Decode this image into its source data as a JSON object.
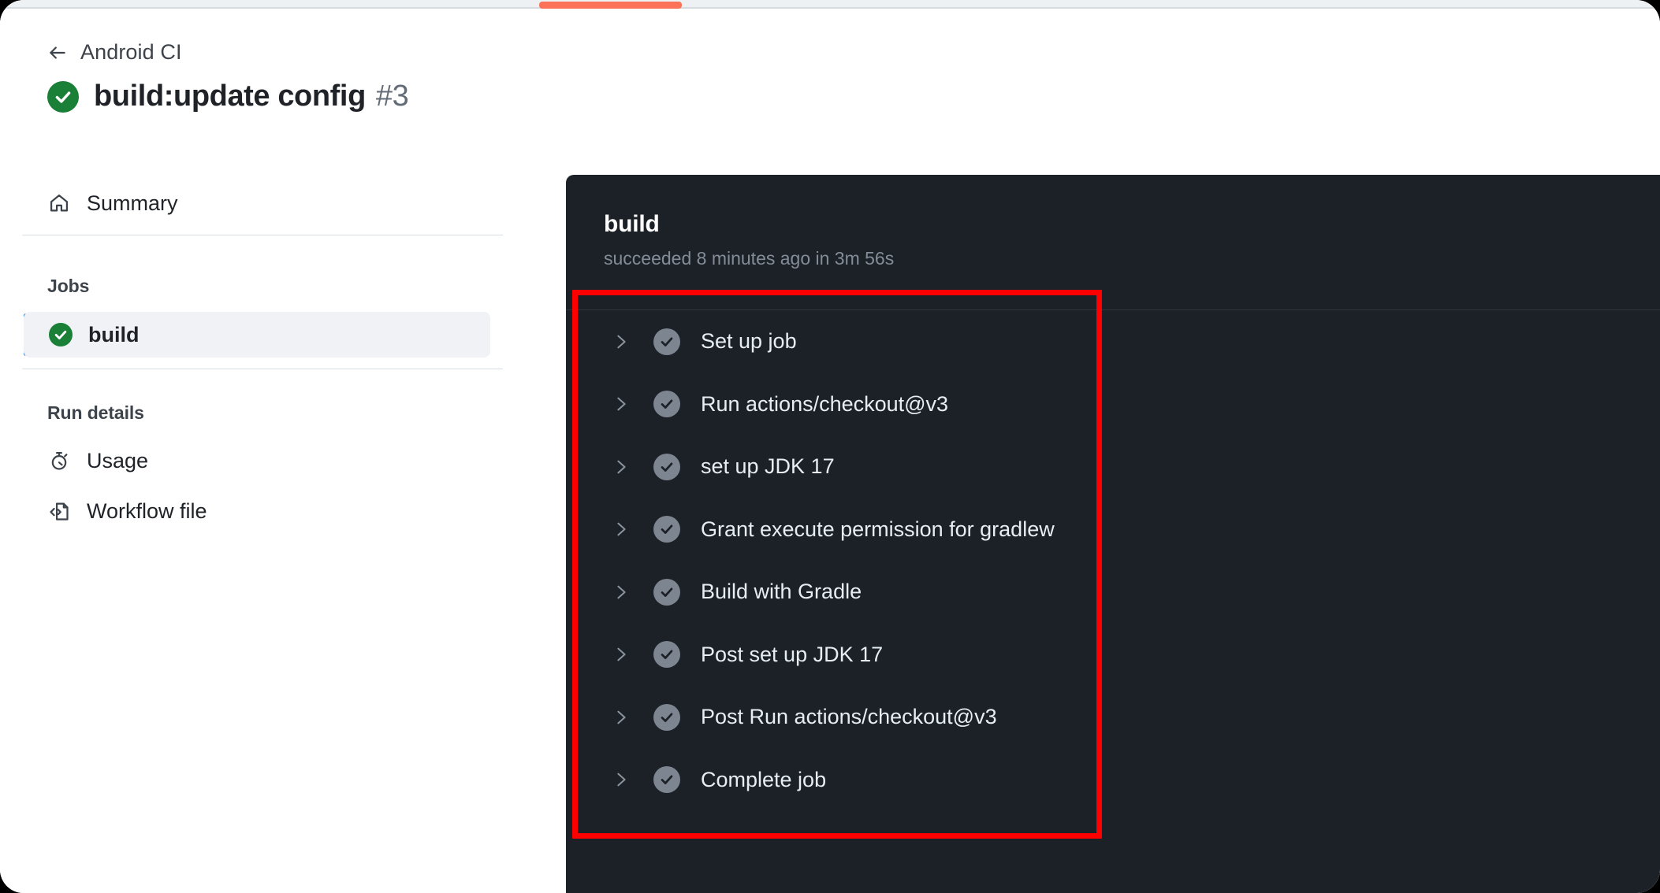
{
  "window": {
    "tab_indicator_color": "#fb7259"
  },
  "sidebar": {
    "breadcrumb": {
      "icon": "arrow-left-icon",
      "label": "Android CI"
    },
    "run_title": {
      "status_icon": "check-circle-icon",
      "status_color": "#1a7f37",
      "text": "build:update config",
      "number": "#3"
    },
    "nav": {
      "summary": {
        "icon": "home-icon",
        "label": "Summary"
      }
    },
    "jobs": {
      "section_label": "Jobs",
      "items": [
        {
          "label": "build",
          "status": "success",
          "status_icon": "check-circle-icon",
          "selected": true,
          "marker_color": "#0969da"
        }
      ]
    },
    "run_details": {
      "section_label": "Run details",
      "items": [
        {
          "icon": "stopwatch-icon",
          "label": "Usage"
        },
        {
          "icon": "workflow-file-icon",
          "label": "Workflow file"
        }
      ]
    }
  },
  "log_panel": {
    "title": "build",
    "subtitle": "succeeded 8 minutes ago in 3m 56s",
    "background": "#1c2128",
    "steps": [
      {
        "label": "Set up job",
        "status": "success",
        "chevron": "chevron-right-icon"
      },
      {
        "label": "Run actions/checkout@v3",
        "status": "success",
        "chevron": "chevron-right-icon"
      },
      {
        "label": "set up JDK 17",
        "status": "success",
        "chevron": "chevron-right-icon"
      },
      {
        "label": "Grant execute permission for gradlew",
        "status": "success",
        "chevron": "chevron-right-icon"
      },
      {
        "label": "Build with Gradle",
        "status": "success",
        "chevron": "chevron-right-icon"
      },
      {
        "label": "Post set up JDK 17",
        "status": "success",
        "chevron": "chevron-right-icon"
      },
      {
        "label": "Post Run actions/checkout@v3",
        "status": "success",
        "chevron": "chevron-right-icon"
      },
      {
        "label": "Complete job",
        "status": "success",
        "chevron": "chevron-right-icon"
      }
    ]
  },
  "annotation": {
    "color": "#ff0000",
    "target": "job-steps-list"
  }
}
